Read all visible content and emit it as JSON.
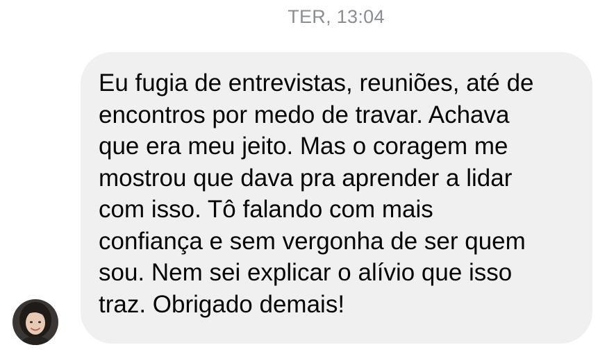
{
  "chat": {
    "timestamp": "TER, 13:04",
    "message": {
      "text": "Eu fugia de entrevistas, reuniões, até de\nencontros por medo de travar. Achava\nque era meu jeito. Mas o coragem me\nmostrou que dava pra aprender a lidar\ncom isso. Tô falando com mais\nconfiança e sem vergonha de ser quem\nsou. Nem sei explicar o alívio que isso\ntraz. Obrigado demais!"
    },
    "sender": {
      "avatar_icon": "user-avatar-photo"
    },
    "colors": {
      "bubble_background": "#f0f0f0",
      "message_text": "#050505",
      "timestamp_text": "#8a8d91"
    }
  }
}
